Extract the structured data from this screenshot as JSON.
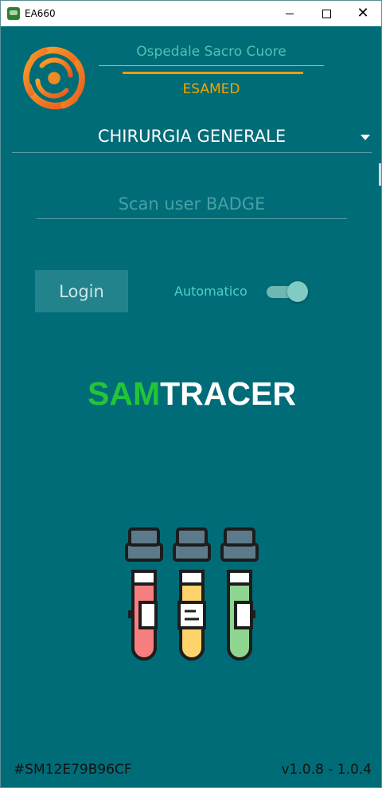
{
  "window": {
    "title": "EA660",
    "icons": [
      "app-icon",
      "minimize-icon",
      "maximize-icon",
      "close-icon"
    ]
  },
  "header": {
    "hospital_name": "Ospedale Sacro Cuore",
    "company": "ESAMED",
    "colors": {
      "hospital": "#4fc3b0",
      "company": "#f0a500",
      "accent_line": "#f39c12"
    }
  },
  "department": {
    "selected": "CHIRURGIA GENERALE"
  },
  "badge": {
    "value": "",
    "placeholder": "Scan user BADGE"
  },
  "login": {
    "button_label": "Login",
    "automatic_label": "Automatico",
    "automatic_on": true
  },
  "brand": {
    "part1": "SAM",
    "part2": "TRACER",
    "colors": {
      "part1": "#22c53a",
      "part2": "#ffffff"
    }
  },
  "illustration": {
    "icon": "test-tubes-icon",
    "tube_colors": [
      "#f87f7f",
      "#fdd36c",
      "#8fd690"
    ]
  },
  "footer": {
    "device_id": "#SM12E79B96CF",
    "version": "v1.0.8 - 1.0.4"
  },
  "theme": {
    "background": "#006c78"
  }
}
